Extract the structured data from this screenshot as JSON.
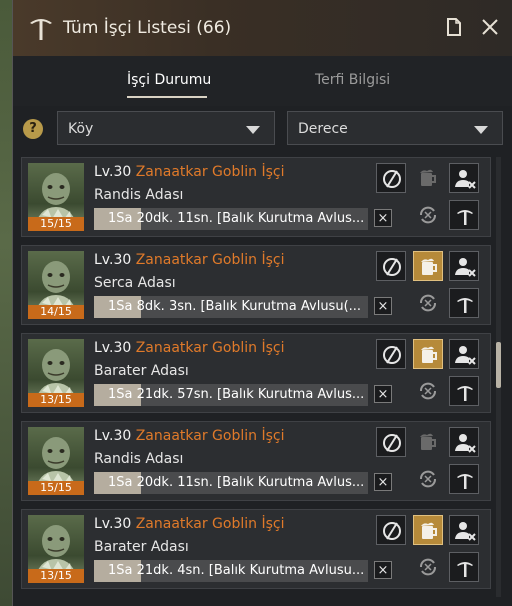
{
  "window": {
    "title": "Tüm İşçi Listesi (66)"
  },
  "tabs": [
    {
      "label": "İşçi Durumu",
      "active": true
    },
    {
      "label": "Terfi Bilgisi",
      "active": false
    }
  ],
  "filters": {
    "help": "?",
    "village": "Köy",
    "grade": "Derece"
  },
  "workers": [
    {
      "lv": "Lv.30",
      "name": "Zanaatkar Goblin İşçi",
      "location": "Randis Adası",
      "stamina": "15/15",
      "progress": 0.17,
      "task": "1Sa 20dk. 11sn. [Balık Kurutma Avlus...",
      "cancel": "×",
      "beer_active": false
    },
    {
      "lv": "Lv.30",
      "name": "Zanaatkar Goblin İşçi",
      "location": "Serca Adası",
      "stamina": "14/15",
      "progress": 0.17,
      "task": "1Sa 8dk. 3sn. [Balık Kurutma Avlusu(...",
      "cancel": "×",
      "beer_active": true
    },
    {
      "lv": "Lv.30",
      "name": "Zanaatkar Goblin İşçi",
      "location": "Barater Adası",
      "stamina": "13/15",
      "progress": 0.17,
      "task": "1Sa 21dk. 57sn. [Balık Kurutma Avlus...",
      "cancel": "×",
      "beer_active": true
    },
    {
      "lv": "Lv.30",
      "name": "Zanaatkar Goblin İşçi",
      "location": "Randis Adası",
      "stamina": "15/15",
      "progress": 0.17,
      "task": "1Sa 20dk. 11sn. [Balık Kurutma Avlus...",
      "cancel": "×",
      "beer_active": false
    },
    {
      "lv": "Lv.30",
      "name": "Zanaatkar Goblin İşçi",
      "location": "Barater Adası",
      "stamina": "13/15",
      "progress": 0.17,
      "task": "1Sa 21dk. 4sn. [Balık Kurutma Avlusu...",
      "cancel": "×",
      "beer_active": true
    }
  ],
  "colors": {
    "accent_orange": "#e07a2a",
    "stamina_bar": "#c86a1a",
    "gold_button": "#b68a3a"
  },
  "icons": [
    "pickaxe-icon",
    "page-icon",
    "close-icon",
    "help-icon",
    "chevron-down-icon",
    "hide-icon",
    "beer-icon",
    "fire-worker-icon",
    "repeat-icon",
    "promote-icon"
  ]
}
